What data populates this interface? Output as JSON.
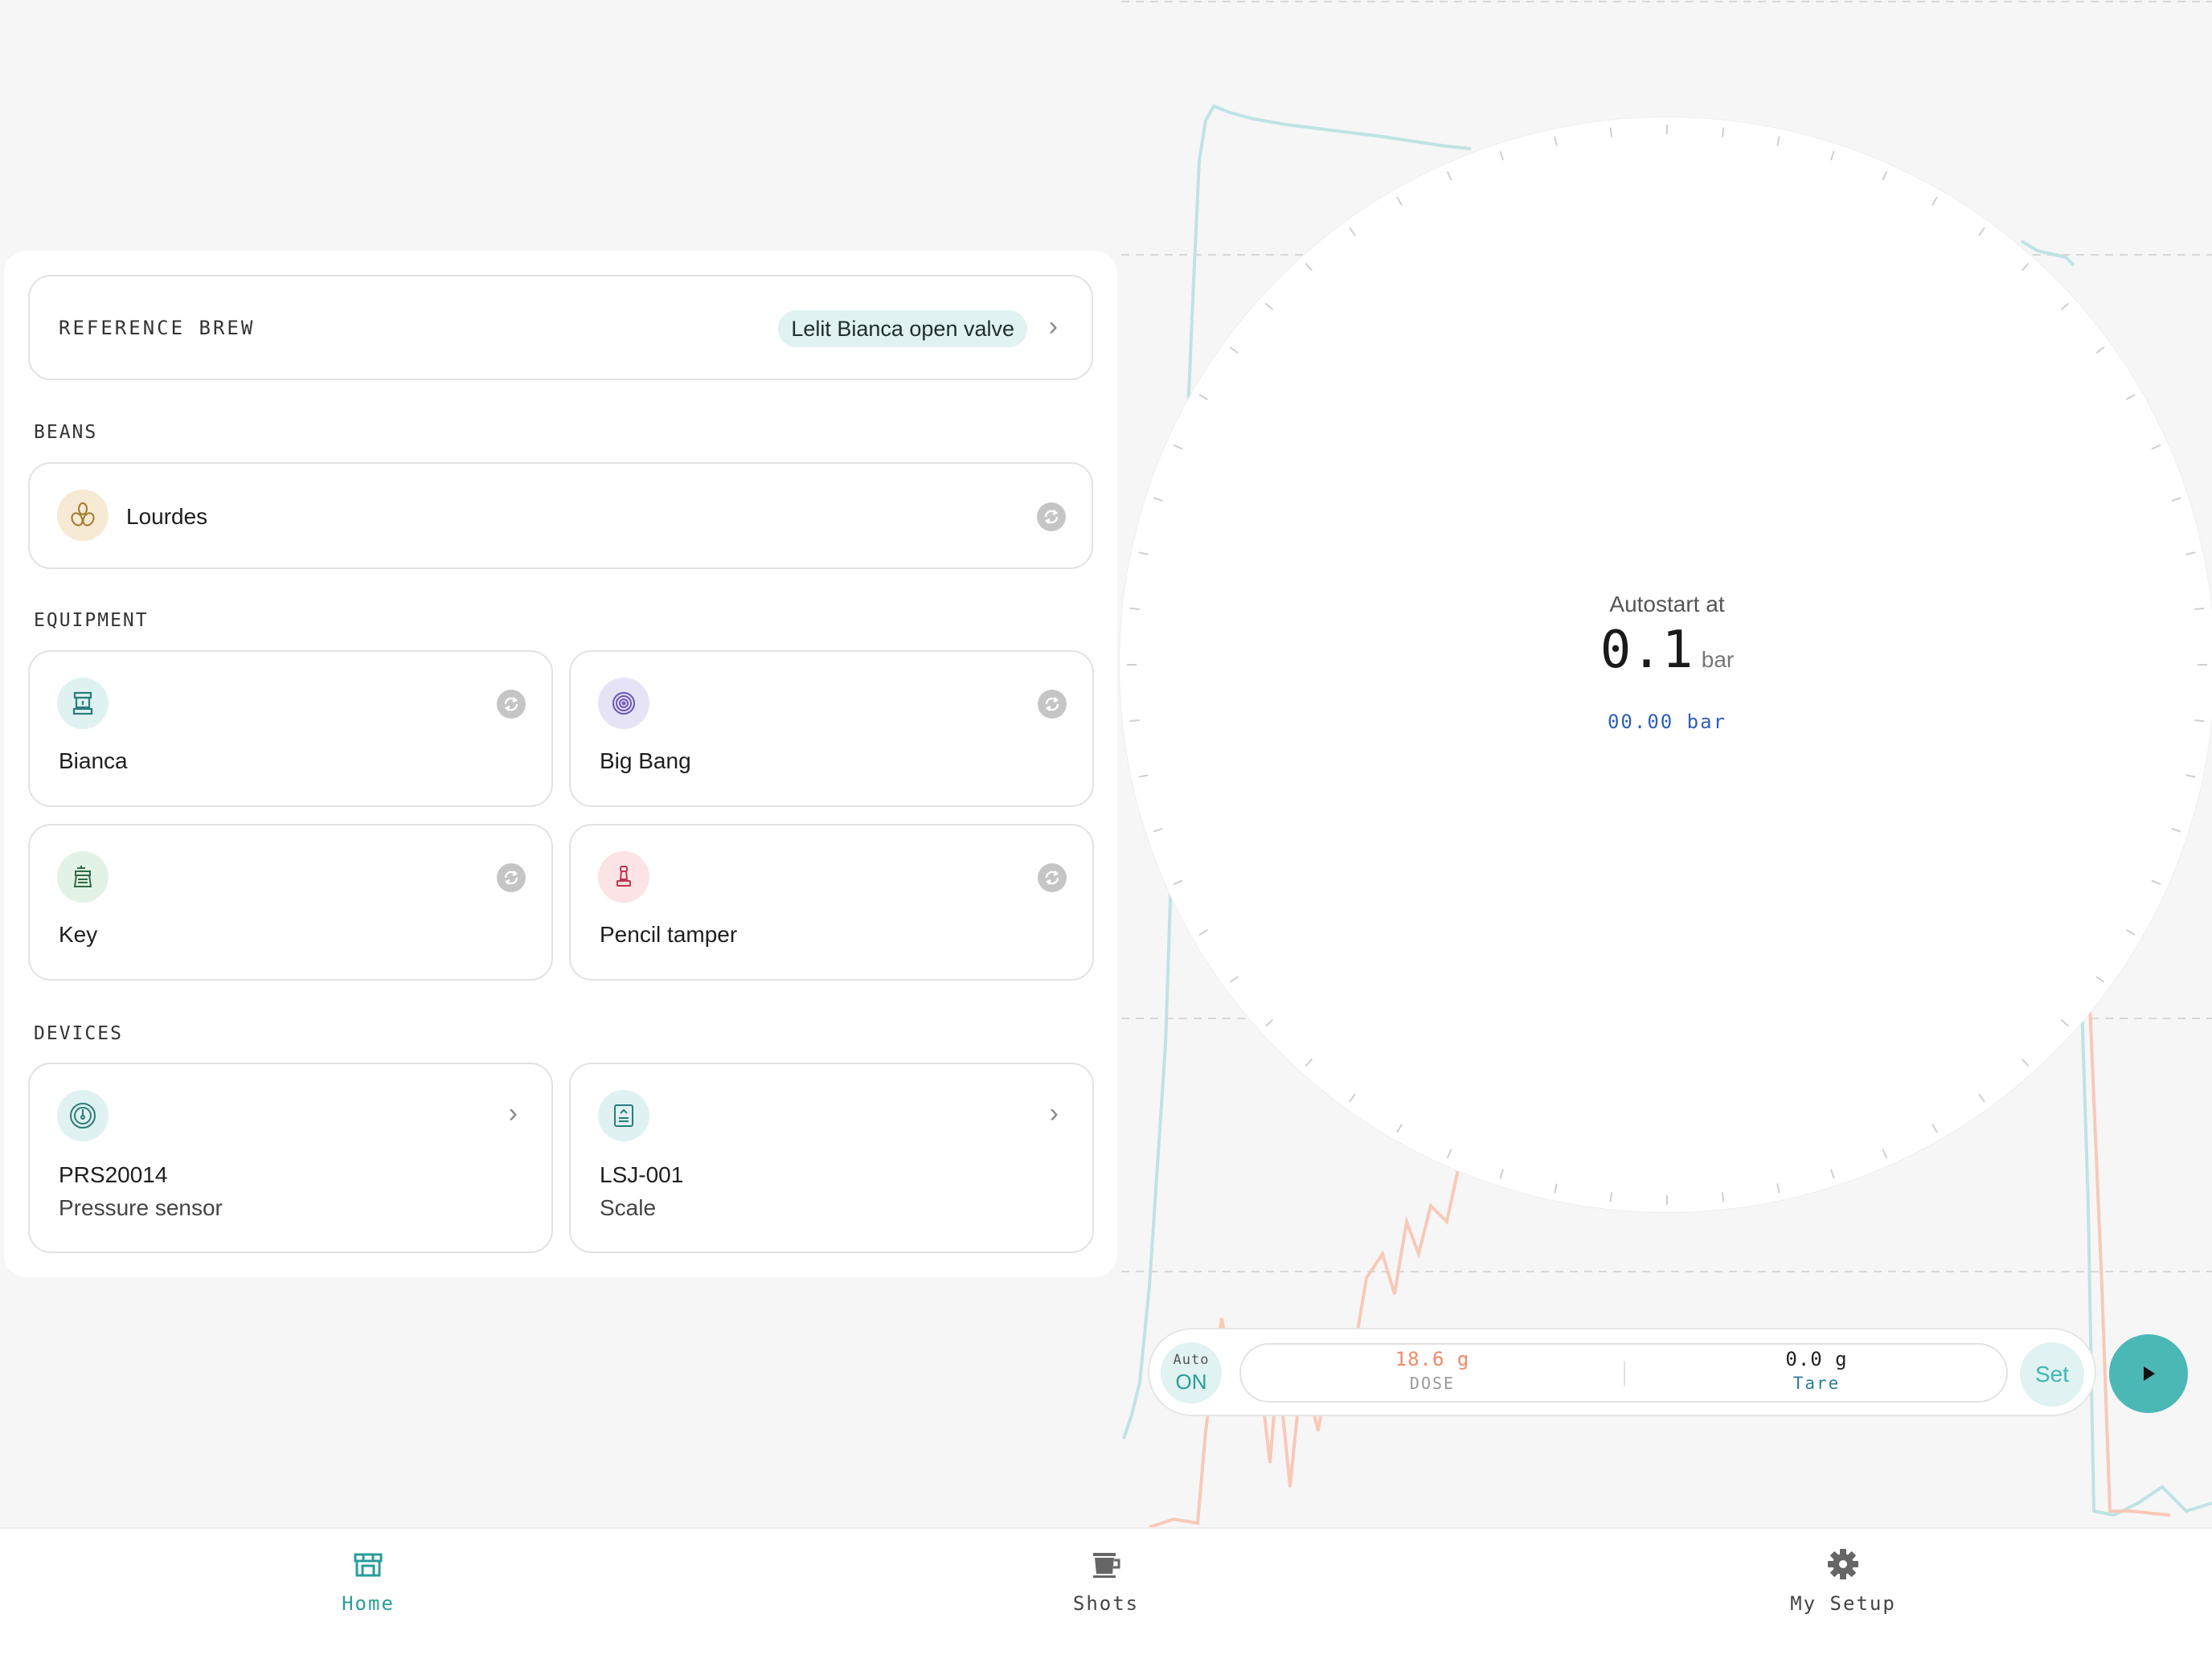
{
  "reference_brew": {
    "label": "REFERENCE BREW",
    "value": "Lelit Bianca open valve"
  },
  "beans": {
    "section_label": "BEANS",
    "name": "Lourdes"
  },
  "equipment": {
    "section_label": "EQUIPMENT",
    "items": [
      {
        "name": "Bianca",
        "icon": "espresso-machine-icon",
        "color": "#dff2f1"
      },
      {
        "name": "Big Bang",
        "icon": "burr-icon",
        "color": "#e7e3f7"
      },
      {
        "name": "Key",
        "icon": "grinder-icon",
        "color": "#e2f2e6"
      },
      {
        "name": "Pencil tamper",
        "icon": "tamper-icon",
        "color": "#fbe3e6"
      }
    ]
  },
  "devices": {
    "section_label": "DEVICES",
    "items": [
      {
        "name": "PRS20014",
        "type": "Pressure sensor",
        "icon": "pressure-gauge-icon"
      },
      {
        "name": "LSJ-001",
        "type": "Scale",
        "icon": "scale-icon"
      }
    ]
  },
  "dial": {
    "title": "Autostart at",
    "value": "0.1",
    "unit": "bar",
    "live_reading": "00.00 bar"
  },
  "controls": {
    "auto_label": "Auto",
    "auto_state": "ON",
    "dose_value": "18.6 g",
    "dose_label": "DOSE",
    "tare_value": "0.0 g",
    "tare_label": "Tare",
    "set_label": "Set"
  },
  "nav": {
    "items": [
      {
        "label": "Home",
        "icon": "store-icon",
        "active": true
      },
      {
        "label": "Shots",
        "icon": "coffee-cup-icon",
        "active": false
      },
      {
        "label": "My Setup",
        "icon": "gear-icon",
        "active": false
      }
    ]
  },
  "colors": {
    "accent": "#2a9d9a",
    "pressure_line": "#bfe3e3",
    "weight_line": "#f8c9b8",
    "dose_text": "#f08a66",
    "live_reading": "#2e5fb8"
  }
}
